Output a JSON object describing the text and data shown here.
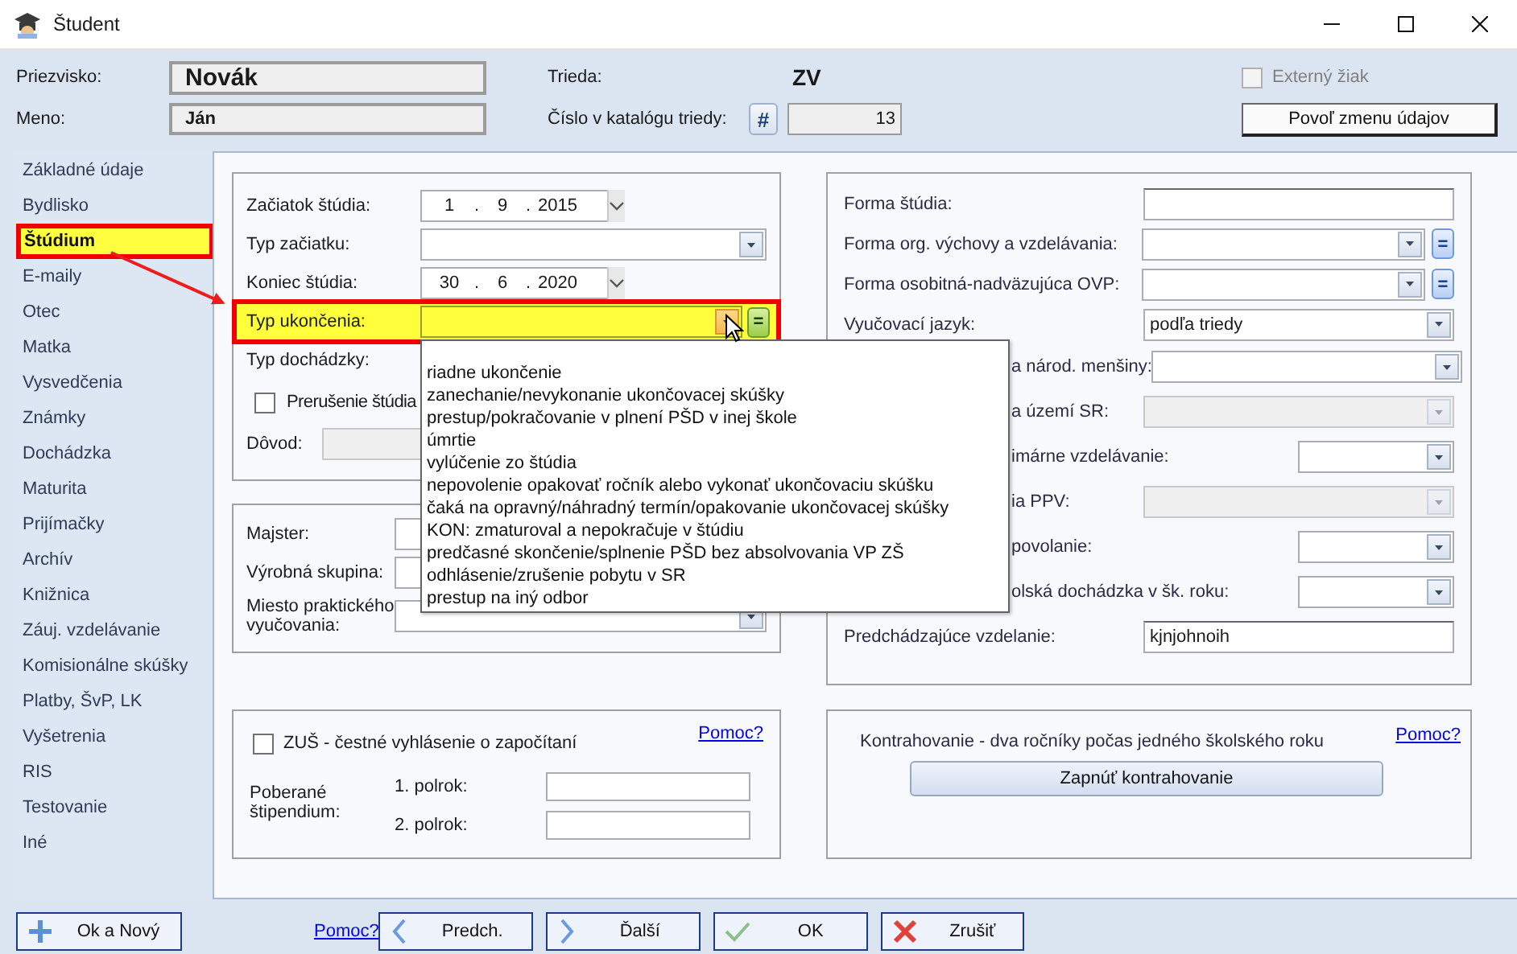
{
  "window": {
    "title": "Študent"
  },
  "student": {
    "surname_label": "Priezvisko:",
    "surname": "Novák",
    "name_label": "Meno:",
    "name": "Ján",
    "class_label": "Trieda:",
    "class": "ZV",
    "catalog_label": "Číslo v katalógu triedy:",
    "catalog_button": "#",
    "catalog_number": "13",
    "external": {
      "label": "Externý žiak",
      "checked": false,
      "disabled": true
    },
    "unlock_button": "Povoľ zmenu údajov"
  },
  "sidebar": {
    "items": [
      {
        "label": "Základné údaje",
        "selected": false
      },
      {
        "label": "Bydlisko",
        "selected": false
      },
      {
        "label": "Štúdium",
        "selected": true
      },
      {
        "label": "E-maily",
        "selected": false
      },
      {
        "label": "Otec",
        "selected": false
      },
      {
        "label": "Matka",
        "selected": false
      },
      {
        "label": "Vysvedčenia",
        "selected": false
      },
      {
        "label": "Známky",
        "selected": false
      },
      {
        "label": "Dochádzka",
        "selected": false
      },
      {
        "label": "Maturita",
        "selected": false
      },
      {
        "label": "Prijímačky",
        "selected": false
      },
      {
        "label": "Archív",
        "selected": false
      },
      {
        "label": "Knižnica",
        "selected": false
      },
      {
        "label": "Záuj. vzdelávanie",
        "selected": false
      },
      {
        "label": "Komisionálne skúšky",
        "selected": false
      },
      {
        "label": "Platby, ŠvP, LK",
        "selected": false
      },
      {
        "label": "Vyšetrenia",
        "selected": false
      },
      {
        "label": "RIS",
        "selected": false
      },
      {
        "label": "Testovanie",
        "selected": false
      },
      {
        "label": "Iné",
        "selected": false
      }
    ]
  },
  "study": {
    "rows": [
      {
        "kind": "date",
        "label": "Začiatok štúdia:",
        "parts": [
          "1",
          ".",
          "9",
          ".",
          "2015"
        ],
        "highlighted": false
      },
      {
        "kind": "combo",
        "label": "Typ začiatku:",
        "highlighted": false
      },
      {
        "kind": "date",
        "label": "Koniec štúdia:",
        "parts": [
          "30",
          ".",
          "6",
          ".",
          "2020"
        ],
        "highlighted": false
      },
      {
        "kind": "combo",
        "label": "Typ ukončenia:",
        "highlighted": true,
        "expanded": true,
        "equals_button": "=",
        "options": [
          {
            "label": "riadne ukončenie",
            "selected": false
          },
          {
            "label": "zanechanie/nevykonanie ukončovacej skúšky",
            "selected": false
          },
          {
            "label": "prestup/pokračovanie v plnení PŠD v inej škole",
            "selected": false
          },
          {
            "label": "úmrtie",
            "selected": false
          },
          {
            "label": "vylúčenie zo štúdia",
            "selected": false
          },
          {
            "label": "nepovolenie opakovať ročník alebo vykonať ukončovaciu skúšku",
            "selected": false
          },
          {
            "label": "čaká na opravný/náhradný termín/opakovanie ukončovacej skúšky",
            "selected": false
          },
          {
            "label": "KON: zmaturoval a nepokračuje v štúdiu",
            "selected": false
          },
          {
            "label": "predčasné skončenie/splnenie PŠD bez absolvovania VP ZŠ",
            "selected": false
          },
          {
            "label": "odhlásenie/zrušenie pobytu v SR",
            "selected": false
          },
          {
            "label": "prestup na iný odbor",
            "selected": false
          }
        ]
      },
      {
        "kind": "label",
        "label": "Typ dochádzky:",
        "highlighted": false
      },
      {
        "kind": "checkbox",
        "label": "Prerušenie štúdia",
        "checked": false,
        "highlighted": false
      },
      {
        "kind": "text",
        "label": "Dôvod:",
        "disabled": true,
        "highlighted": false
      }
    ]
  },
  "workplace": {
    "rows": [
      {
        "kind": "text",
        "label": "Majster:"
      },
      {
        "kind": "text",
        "label": "Výrobná skupina:"
      },
      {
        "kind": "combo",
        "label": "Miesto praktického vyučovania:"
      }
    ]
  },
  "zus": {
    "label": "ZUŠ - čestné vyhlásenie o započítaní",
    "checked": false,
    "help_link": "Pomoc?",
    "stipend_label": "Poberané štipendium:",
    "rows": [
      {
        "label": "1. polrok:"
      },
      {
        "label": "2. polrok:"
      }
    ]
  },
  "details": {
    "rows": [
      {
        "kind": "text",
        "label": "Forma štúdia:",
        "disabled": false
      },
      {
        "kind": "combo",
        "label": "Forma org. výchovy a vzdelávania:",
        "equals_button": "=",
        "disabled": false
      },
      {
        "kind": "combo",
        "label": "Forma osobitná-nadväzujúca OVP:",
        "equals_button": "=",
        "disabled": false
      },
      {
        "kind": "combo",
        "label": "Vyučovací jazyk:",
        "value": "podľa triedy",
        "disabled": false
      },
      {
        "kind": "combo",
        "label": "a národ. menšiny:",
        "disabled": false
      },
      {
        "kind": "combo",
        "label": "a území SR:",
        "disabled": true
      },
      {
        "kind": "short-combo",
        "label": "imárne vzdelávanie:",
        "disabled": false
      },
      {
        "kind": "combo",
        "label": "ia PPV:",
        "disabled": true
      },
      {
        "kind": "short-combo",
        "label": "povolanie:",
        "disabled": false
      },
      {
        "kind": "short-combo",
        "label": "olská dochádzka v šk. roku:",
        "disabled": false
      },
      {
        "kind": "text",
        "label": "Predchádzajúce vzdelanie:",
        "value": "kjnjohnoih",
        "disabled": false
      }
    ]
  },
  "contracting": {
    "text": "Kontrahovanie - dva ročníky počas jedného školského roku",
    "help_link": "Pomoc?",
    "button": "Zapnúť kontrahovanie"
  },
  "footer": {
    "ok_new": "Ok a Nový",
    "help_link": "Pomoc?",
    "buttons": [
      {
        "kind": "prev",
        "label": "Predch."
      },
      {
        "kind": "next",
        "label": "Ďalší"
      },
      {
        "kind": "ok",
        "label": "OK"
      },
      {
        "kind": "cancel",
        "label": "Zrušiť"
      }
    ]
  }
}
